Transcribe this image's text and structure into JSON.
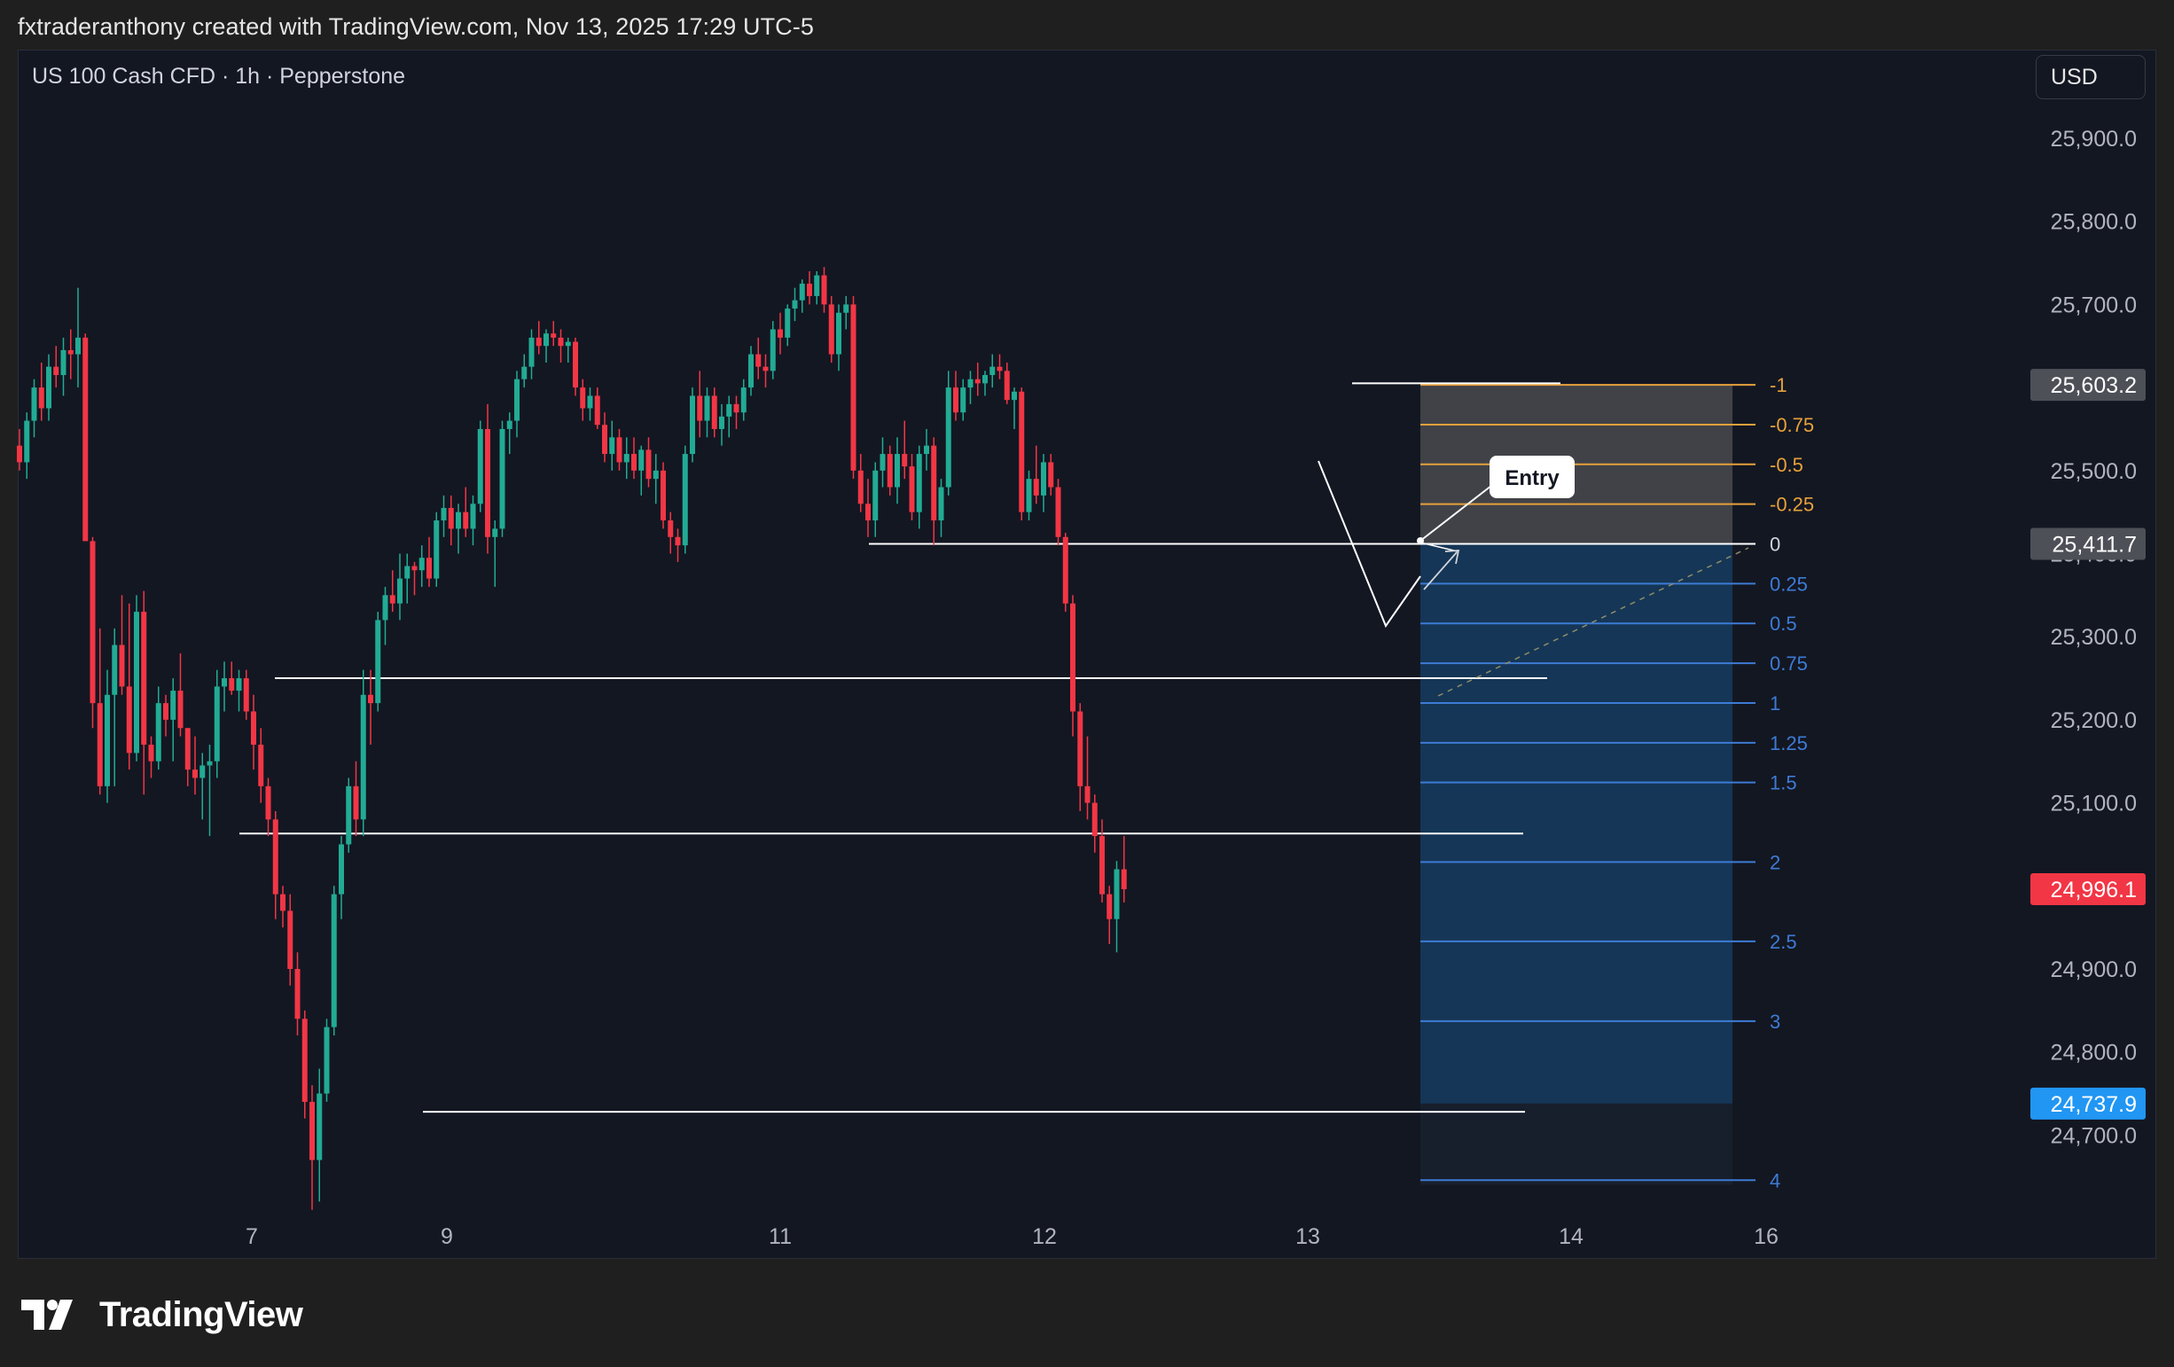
{
  "header": {
    "credit": "fxtraderanthony created with TradingView.com, Nov 13, 2025 17:29 UTC-5"
  },
  "legend": {
    "symbol": "US 100 Cash CFD · 1h · Pepperstone"
  },
  "currency_button": "USD",
  "footer": {
    "brand": "TradingView"
  },
  "colors": {
    "background": "#131722",
    "bull": "#22ab94",
    "bear": "#f23645",
    "level_line": "#ffffff",
    "fib_negative": "#e8a13b",
    "fib_positive": "#3d7bd5",
    "stop_zone": "#4a4a4f",
    "target_zone": "#163a5c",
    "label_red": "#f23645",
    "label_blue": "#2196f3",
    "label_gray": "#4e5058"
  },
  "chart_data": {
    "type": "candlestick",
    "y_ticks": [
      "25,900.0",
      "25,800.0",
      "25,700.0",
      "25,600.0",
      "25,500.0",
      "25,400.0",
      "25,300.0",
      "25,200.0",
      "25,100.0",
      "25,000.0",
      "24,900.0",
      "24,800.0",
      "24,700.0"
    ],
    "ylim": [
      24630,
      25970
    ],
    "x_ticks": [
      "7",
      "9",
      "11",
      "12",
      "13",
      "14",
      "16"
    ],
    "price_labels": [
      {
        "text": "25,603.2",
        "value": 25603.2,
        "style": "gray"
      },
      {
        "text": "25,411.7",
        "value": 25411.7,
        "style": "gray"
      },
      {
        "text": "24,996.1",
        "value": 24996.1,
        "style": "red"
      },
      {
        "text": "24,737.9",
        "value": 24737.9,
        "style": "blue"
      }
    ],
    "horizontal_levels": [
      25411.7,
      25250,
      25063,
      24728
    ],
    "fib_levels": [
      {
        "label": "-1",
        "value": 25603.2
      },
      {
        "label": "-0.75",
        "value": 25555.3
      },
      {
        "label": "-0.5",
        "value": 25507.5
      },
      {
        "label": "-0.25",
        "value": 25459.6
      },
      {
        "label": "0",
        "value": 25411.7
      },
      {
        "label": "0.25",
        "value": 25363.8
      },
      {
        "label": "0.5",
        "value": 25316.0
      },
      {
        "label": "0.75",
        "value": 25268.1
      },
      {
        "label": "1",
        "value": 25220.2
      },
      {
        "label": "1.25",
        "value": 25172.3
      },
      {
        "label": "1.5",
        "value": 25124.5
      },
      {
        "label": "2",
        "value": 25028.7
      },
      {
        "label": "2.5",
        "value": 24933.2
      },
      {
        "label": "3",
        "value": 24837.2
      },
      {
        "label": "4",
        "value": 24645.7
      }
    ],
    "entry_annotation": "Entry",
    "position": {
      "stop": 25603.2,
      "entry": 25411.7,
      "target": 24737.9
    },
    "candles": [
      [
        25530,
        25550,
        25500,
        25510
      ],
      [
        25510,
        25570,
        25490,
        25560
      ],
      [
        25560,
        25610,
        25540,
        25600
      ],
      [
        25600,
        25630,
        25560,
        25575
      ],
      [
        25575,
        25640,
        25560,
        25625
      ],
      [
        25625,
        25650,
        25600,
        25615
      ],
      [
        25615,
        25660,
        25590,
        25645
      ],
      [
        25645,
        25670,
        25610,
        25640
      ],
      [
        25640,
        25720,
        25600,
        25660
      ],
      [
        25660,
        25665,
        25420,
        25415
      ],
      [
        25415,
        25420,
        25190,
        25220
      ],
      [
        25220,
        25310,
        25110,
        25120
      ],
      [
        25120,
        25260,
        25100,
        25230
      ],
      [
        25230,
        25310,
        25120,
        25290
      ],
      [
        25290,
        25350,
        25230,
        25240
      ],
      [
        25240,
        25340,
        25140,
        25160
      ],
      [
        25160,
        25350,
        25150,
        25330
      ],
      [
        25330,
        25355,
        25110,
        25170
      ],
      [
        25170,
        25180,
        25130,
        25150
      ],
      [
        25150,
        25240,
        25140,
        25220
      ],
      [
        25220,
        25230,
        25180,
        25200
      ],
      [
        25200,
        25250,
        25150,
        25235
      ],
      [
        25235,
        25280,
        25180,
        25190
      ],
      [
        25190,
        25190,
        25120,
        25140
      ],
      [
        25140,
        25180,
        25110,
        25130
      ],
      [
        25130,
        25160,
        25080,
        25145
      ],
      [
        25145,
        25170,
        25060,
        25150
      ],
      [
        25150,
        25260,
        25130,
        25240
      ],
      [
        25240,
        25270,
        25210,
        25250
      ],
      [
        25250,
        25270,
        25230,
        25235
      ],
      [
        25235,
        25260,
        25210,
        25250
      ],
      [
        25250,
        25260,
        25200,
        25210
      ],
      [
        25210,
        25230,
        25140,
        25170
      ],
      [
        25170,
        25190,
        25100,
        25120
      ],
      [
        25120,
        25130,
        25060,
        25080
      ],
      [
        25080,
        25090,
        24960,
        24990
      ],
      [
        24990,
        25000,
        24950,
        24970
      ],
      [
        24970,
        24990,
        24880,
        24900
      ],
      [
        24900,
        24920,
        24820,
        24840
      ],
      [
        24840,
        24850,
        24720,
        24740
      ],
      [
        24740,
        24760,
        24610,
        24670
      ],
      [
        24670,
        24780,
        24620,
        24750
      ],
      [
        24750,
        24840,
        24740,
        24830
      ],
      [
        24830,
        25000,
        24820,
        24990
      ],
      [
        24990,
        25060,
        24960,
        25050
      ],
      [
        25050,
        25130,
        25040,
        25120
      ],
      [
        25120,
        25150,
        25060,
        25080
      ],
      [
        25080,
        25260,
        25060,
        25230
      ],
      [
        25230,
        25260,
        25170,
        25220
      ],
      [
        25220,
        25330,
        25210,
        25320
      ],
      [
        25320,
        25360,
        25290,
        25350
      ],
      [
        25350,
        25380,
        25330,
        25340
      ],
      [
        25340,
        25400,
        25320,
        25370
      ],
      [
        25370,
        25400,
        25340,
        25385
      ],
      [
        25385,
        25390,
        25350,
        25380
      ],
      [
        25380,
        25410,
        25360,
        25395
      ],
      [
        25395,
        25420,
        25360,
        25370
      ],
      [
        25370,
        25450,
        25360,
        25440
      ],
      [
        25440,
        25470,
        25420,
        25455
      ],
      [
        25455,
        25470,
        25410,
        25430
      ],
      [
        25430,
        25460,
        25400,
        25450
      ],
      [
        25450,
        25480,
        25420,
        25430
      ],
      [
        25430,
        25470,
        25410,
        25460
      ],
      [
        25460,
        25560,
        25450,
        25550
      ],
      [
        25550,
        25580,
        25400,
        25420
      ],
      [
        25420,
        25440,
        25360,
        25430
      ],
      [
        25430,
        25560,
        25420,
        25550
      ],
      [
        25550,
        25570,
        25520,
        25560
      ],
      [
        25560,
        25620,
        25540,
        25610
      ],
      [
        25610,
        25640,
        25600,
        25625
      ],
      [
        25625,
        25670,
        25610,
        25660
      ],
      [
        25660,
        25680,
        25640,
        25650
      ],
      [
        25650,
        25670,
        25630,
        25665
      ],
      [
        25665,
        25680,
        25650,
        25660
      ],
      [
        25660,
        25670,
        25630,
        25650
      ],
      [
        25650,
        25660,
        25630,
        25655
      ],
      [
        25655,
        25660,
        25590,
        25600
      ],
      [
        25600,
        25610,
        25560,
        25575
      ],
      [
        25575,
        25600,
        25560,
        25590
      ],
      [
        25590,
        25600,
        25550,
        25555
      ],
      [
        25555,
        25570,
        25510,
        25520
      ],
      [
        25520,
        25560,
        25500,
        25540
      ],
      [
        25540,
        25550,
        25500,
        25510
      ],
      [
        25510,
        25540,
        25490,
        25520
      ],
      [
        25520,
        25540,
        25490,
        25500
      ],
      [
        25500,
        25530,
        25470,
        25525
      ],
      [
        25525,
        25540,
        25480,
        25490
      ],
      [
        25490,
        25520,
        25460,
        25500
      ],
      [
        25500,
        25510,
        25430,
        25440
      ],
      [
        25440,
        25450,
        25400,
        25420
      ],
      [
        25420,
        25430,
        25390,
        25410
      ],
      [
        25410,
        25530,
        25400,
        25520
      ],
      [
        25520,
        25600,
        25510,
        25590
      ],
      [
        25590,
        25620,
        25540,
        25560
      ],
      [
        25560,
        25600,
        25540,
        25590
      ],
      [
        25590,
        25600,
        25540,
        25550
      ],
      [
        25550,
        25580,
        25530,
        25565
      ],
      [
        25565,
        25590,
        25540,
        25580
      ],
      [
        25580,
        25590,
        25550,
        25570
      ],
      [
        25570,
        25610,
        25560,
        25600
      ],
      [
        25600,
        25650,
        25590,
        25640
      ],
      [
        25640,
        25660,
        25610,
        25625
      ],
      [
        25625,
        25640,
        25600,
        25620
      ],
      [
        25620,
        25680,
        25610,
        25670
      ],
      [
        25670,
        25690,
        25640,
        25660
      ],
      [
        25660,
        25700,
        25650,
        25695
      ],
      [
        25695,
        25720,
        25680,
        25705
      ],
      [
        25705,
        25730,
        25690,
        25725
      ],
      [
        25725,
        25740,
        25700,
        25710
      ],
      [
        25710,
        25740,
        25700,
        25735
      ],
      [
        25735,
        25745,
        25690,
        25700
      ],
      [
        25700,
        25710,
        25630,
        25640
      ],
      [
        25640,
        25700,
        25620,
        25690
      ],
      [
        25690,
        25710,
        25670,
        25700
      ],
      [
        25700,
        25710,
        25490,
        25500
      ],
      [
        25500,
        25520,
        25450,
        25460
      ],
      [
        25460,
        25490,
        25420,
        25440
      ],
      [
        25440,
        25510,
        25420,
        25500
      ],
      [
        25500,
        25540,
        25480,
        25520
      ],
      [
        25520,
        25530,
        25470,
        25480
      ],
      [
        25480,
        25540,
        25460,
        25520
      ],
      [
        25520,
        25560,
        25490,
        25505
      ],
      [
        25505,
        25520,
        25440,
        25450
      ],
      [
        25450,
        25530,
        25430,
        25520
      ],
      [
        25520,
        25550,
        25500,
        25530
      ],
      [
        25530,
        25540,
        25410,
        25440
      ],
      [
        25440,
        25490,
        25420,
        25480
      ],
      [
        25480,
        25620,
        25470,
        25600
      ],
      [
        25600,
        25620,
        25560,
        25570
      ],
      [
        25570,
        25610,
        25560,
        25600
      ],
      [
        25600,
        25620,
        25580,
        25610
      ],
      [
        25610,
        25630,
        25590,
        25605
      ],
      [
        25605,
        25620,
        25590,
        25615
      ],
      [
        25615,
        25640,
        25600,
        25625
      ],
      [
        25625,
        25640,
        25610,
        25620
      ],
      [
        25620,
        25630,
        25580,
        25585
      ],
      [
        25585,
        25600,
        25550,
        25595
      ],
      [
        25595,
        25600,
        25440,
        25450
      ],
      [
        25450,
        25500,
        25440,
        25490
      ],
      [
        25490,
        25530,
        25460,
        25470
      ],
      [
        25470,
        25520,
        25450,
        25510
      ],
      [
        25510,
        25520,
        25470,
        25480
      ],
      [
        25480,
        25490,
        25410,
        25420
      ],
      [
        25420,
        25425,
        25330,
        25340
      ],
      [
        25340,
        25350,
        25180,
        25210
      ],
      [
        25210,
        25220,
        25090,
        25120
      ],
      [
        25120,
        25180,
        25080,
        25100
      ],
      [
        25100,
        25110,
        25040,
        25060
      ],
      [
        25060,
        25080,
        24980,
        24990
      ],
      [
        24990,
        25000,
        24930,
        24960
      ],
      [
        24960,
        25030,
        24920,
        25020
      ],
      [
        25020,
        25060,
        24980,
        24996
      ]
    ]
  }
}
